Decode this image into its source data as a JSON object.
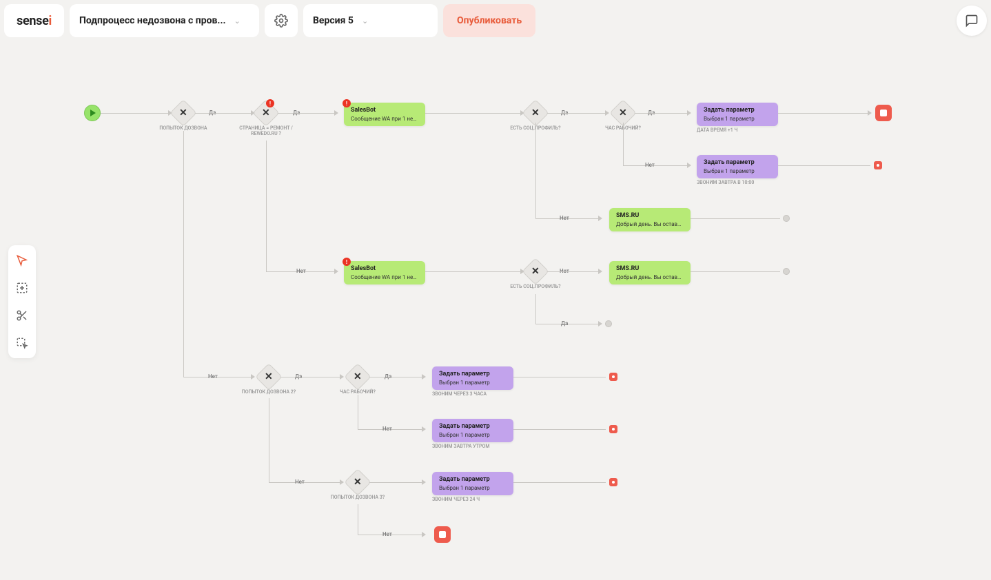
{
  "header": {
    "logo_prefix": "sense",
    "logo_suffix": "i",
    "process_name": "Подпроцесс недозвона с пров...",
    "version": "Версия 5",
    "publish": "Опубликовать"
  },
  "labels": {
    "yes": "Да",
    "no": "Нет"
  },
  "conditions": {
    "c1": "ПОПЫТОК ДОЗВОНА",
    "c2": "СТРАНИЦА = РЕМОНТ / REWEDO.RU ?",
    "c3": "ЕСТЬ СОЦ.ПРОФИЛЬ?",
    "c4": "ЧАС РАБОЧИЙ?",
    "c5": "ЕСТЬ СОЦ.ПРОФИЛЬ?",
    "c7": "ПОПЫТОК ДОЗВОНА 2?",
    "c8": "ЧАС РАБОЧИЙ?",
    "c9": "ПОПЫТОК ДОЗВОНА 3?"
  },
  "actions": {
    "a1": {
      "title": "SalesBot",
      "sub": "Сообщение WA при 1 нед..."
    },
    "a2": {
      "title": "Задать параметр",
      "sub": "Выбран 1 параметр",
      "cap": "ДАТА ВРЕМЯ +1 Ч"
    },
    "a3": {
      "title": "Задать параметр",
      "sub": "Выбран 1 параметр",
      "cap": "ЗВОНИМ ЗАВТРА В 10:00"
    },
    "a4": {
      "title": "SMS.RU",
      "sub": "Добрый день. Вы остави..."
    },
    "a5": {
      "title": "SalesBot",
      "sub": "Сообщение WA при 1 нед..."
    },
    "a6": {
      "title": "SMS.RU",
      "sub": "Добрый день. Вы остави..."
    },
    "a7": {
      "title": "Задать параметр",
      "sub": "Выбран 1 параметр",
      "cap": "ЗВОНИМ ЧЕРЕЗ 3 ЧАСА"
    },
    "a8": {
      "title": "Задать параметр",
      "sub": "Выбран 1 параметр",
      "cap": "ЗВОНИМ ЗАВТРА УТРОМ"
    },
    "a9": {
      "title": "Задать параметр",
      "sub": "Выбран 1 параметр",
      "cap": "ЗВОНИМ ЧЕРЕЗ 24 Ч"
    }
  }
}
